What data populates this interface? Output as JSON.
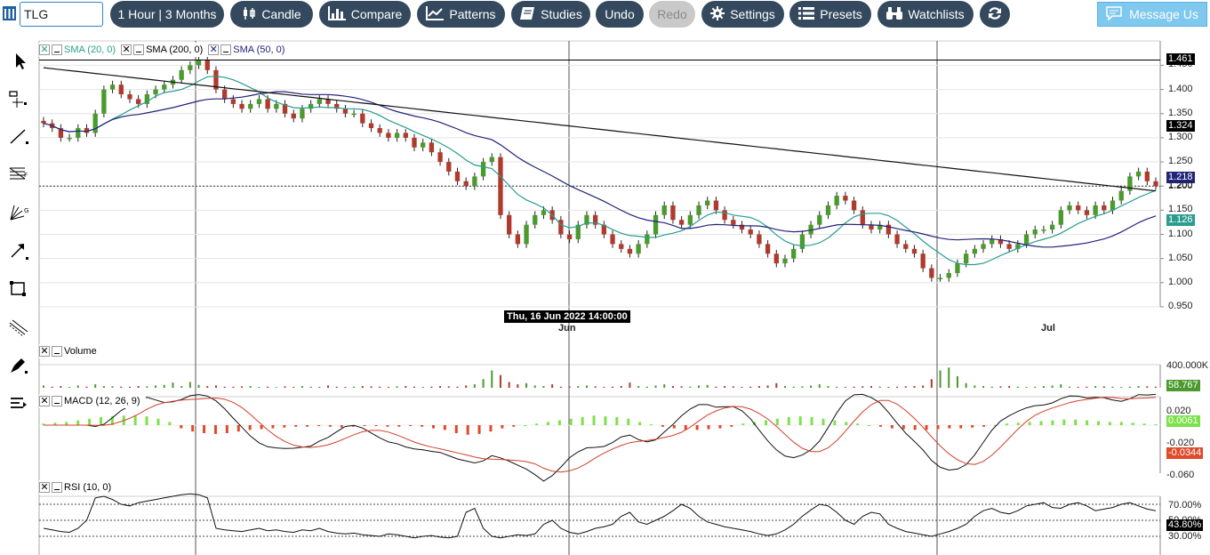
{
  "toolbar": {
    "symbol": "TLG",
    "interval": "1 Hour | 3 Months",
    "candle": "Candle",
    "compare": "Compare",
    "patterns": "Patterns",
    "studies": "Studies",
    "undo": "Undo",
    "redo": "Redo",
    "settings": "Settings",
    "presets": "Presets",
    "watchlists": "Watchlists",
    "message": "Message Us"
  },
  "price_pane": {
    "studies": [
      {
        "label": "SMA (20, 0)",
        "color": "#2a9d8f"
      },
      {
        "label": "SMA (200, 0)",
        "color": "#111111"
      },
      {
        "label": "SMA (50, 0)",
        "color": "#22237a"
      }
    ],
    "ticks": [
      "1.450",
      "1.400",
      "1.350",
      "1.300",
      "1.250",
      "1.200",
      "1.150",
      "1.100",
      "1.050",
      "1.000",
      "0.950"
    ],
    "tags": {
      "high": "1.461",
      "sma200": "1.324",
      "sma50": "1.218",
      "last": "1.200",
      "sma20": "1.126"
    }
  },
  "x_axis": {
    "crosshair": "Thu, 16 Jun 2022 14:00:00",
    "labels": [
      "Jun",
      "Jul"
    ]
  },
  "volume_pane": {
    "label": "Volume",
    "tick": "400.000K",
    "tag": "58.767"
  },
  "macd_pane": {
    "label": "MACD (12, 26, 9)",
    "ticks": [
      "0.020",
      "-0.020",
      "-0.060"
    ],
    "tag_hist": "0.0061",
    "tag_signal": "-0.0344"
  },
  "rsi_pane": {
    "label": "RSI (10, 0)",
    "ticks": [
      "70.00%",
      "50.00%",
      "30.00%"
    ],
    "tag": "43.80%"
  },
  "colors": {
    "button": "#34495e",
    "up": "#4a9a2e",
    "down": "#b03a2e",
    "sma20": "#2a9d8f",
    "sma200": "#111111",
    "sma50": "#22237a",
    "macd_pos": "#7de24a",
    "macd_neg": "#e04a2a"
  },
  "chart_data": {
    "type": "candlestick",
    "instrument": "TLG",
    "close_approx": [
      1.33,
      1.32,
      1.3,
      1.3,
      1.32,
      1.31,
      1.35,
      1.4,
      1.41,
      1.39,
      1.38,
      1.37,
      1.39,
      1.4,
      1.41,
      1.42,
      1.44,
      1.45,
      1.46,
      1.44,
      1.4,
      1.38,
      1.37,
      1.36,
      1.37,
      1.38,
      1.36,
      1.37,
      1.35,
      1.34,
      1.36,
      1.37,
      1.38,
      1.37,
      1.36,
      1.35,
      1.35,
      1.33,
      1.32,
      1.31,
      1.3,
      1.31,
      1.3,
      1.28,
      1.29,
      1.27,
      1.25,
      1.23,
      1.21,
      1.2,
      1.22,
      1.25,
      1.26,
      1.14,
      1.1,
      1.08,
      1.12,
      1.14,
      1.15,
      1.13,
      1.1,
      1.09,
      1.12,
      1.14,
      1.12,
      1.1,
      1.08,
      1.07,
      1.06,
      1.08,
      1.1,
      1.14,
      1.16,
      1.13,
      1.12,
      1.14,
      1.16,
      1.17,
      1.15,
      1.13,
      1.12,
      1.11,
      1.1,
      1.08,
      1.06,
      1.04,
      1.05,
      1.07,
      1.1,
      1.12,
      1.14,
      1.16,
      1.18,
      1.17,
      1.15,
      1.12,
      1.11,
      1.12,
      1.1,
      1.08,
      1.07,
      1.06,
      1.03,
      1.01,
      1.01,
      1.02,
      1.04,
      1.06,
      1.07,
      1.08,
      1.09,
      1.08,
      1.07,
      1.08,
      1.1,
      1.11,
      1.11,
      1.12,
      1.15,
      1.16,
      1.15,
      1.14,
      1.16,
      1.15,
      1.17,
      1.19,
      1.22,
      1.23,
      1.21,
      1.2
    ],
    "volume_approx": [
      40,
      20,
      30,
      15,
      40,
      20,
      60,
      30,
      25,
      20,
      18,
      30,
      25,
      40,
      50,
      90,
      30,
      100,
      50,
      30,
      40,
      20,
      18,
      25,
      30,
      15,
      20,
      12,
      25,
      15,
      30,
      20,
      18,
      40,
      20,
      15,
      20,
      30,
      25,
      20,
      15,
      25,
      30,
      20,
      15,
      20,
      30,
      25,
      20,
      40,
      60,
      150,
      300,
      220,
      100,
      60,
      80,
      40,
      30,
      60,
      20,
      25,
      30,
      40,
      25,
      15,
      20,
      30,
      90,
      30,
      20,
      40,
      60,
      30,
      25,
      20,
      40,
      50,
      20,
      30,
      25,
      15,
      20,
      30,
      40,
      80,
      30,
      20,
      25,
      40,
      60,
      30,
      20,
      15,
      20,
      25,
      30,
      20,
      15,
      20,
      25,
      30,
      40,
      150,
      300,
      350,
      200,
      80,
      40,
      30,
      20,
      25,
      30,
      20,
      15,
      20,
      30,
      40,
      60,
      20,
      15,
      20,
      30,
      25,
      20,
      15,
      20,
      30,
      25,
      20,
      30
    ],
    "macd_hist_approx": [
      0.002,
      0.003,
      0.004,
      0.006,
      0.008,
      0.01,
      0.011,
      0.012,
      0.012,
      0.011,
      0.008,
      0.004,
      -0.004,
      -0.008,
      -0.01,
      -0.011,
      -0.01,
      -0.008,
      -0.006,
      -0.005,
      -0.004,
      -0.003,
      -0.002,
      -0.002,
      -0.001,
      -0.002,
      -0.003,
      -0.002,
      -0.001,
      -0.001,
      -0.002,
      -0.002,
      -0.001,
      -0.002,
      -0.004,
      -0.006,
      -0.01,
      -0.012,
      -0.011,
      -0.008,
      -0.004,
      -0.002,
      0.0,
      0.002,
      0.004,
      0.006,
      0.008,
      0.01,
      0.012,
      0.011,
      0.01,
      0.008,
      0.004,
      0.001,
      -0.002,
      -0.004,
      -0.006,
      -0.006,
      -0.005,
      -0.004,
      -0.002,
      0.002,
      0.004,
      0.006,
      0.008,
      0.01,
      0.011,
      0.01,
      0.008,
      0.006,
      0.004,
      0.002,
      0.0,
      -0.002,
      -0.004,
      -0.005,
      -0.006,
      -0.006,
      -0.005,
      -0.004,
      -0.004,
      -0.003,
      -0.002,
      0.0,
      0.002,
      0.003,
      0.004,
      0.005,
      0.006,
      0.007,
      0.007,
      0.006,
      0.005,
      0.004,
      0.004,
      0.003,
      0.002,
      0.001
    ],
    "rsi_approx": [
      40,
      38,
      36,
      35,
      40,
      50,
      78,
      80,
      76,
      70,
      68,
      72,
      74,
      76,
      78,
      80,
      82,
      83,
      82,
      78,
      40,
      38,
      37,
      36,
      38,
      40,
      37,
      38,
      36,
      35,
      38,
      37,
      40,
      36,
      34,
      33,
      34,
      32,
      31,
      30,
      33,
      32,
      30,
      28,
      30,
      31,
      29,
      28,
      30,
      60,
      65,
      40,
      30,
      28,
      30,
      32,
      31,
      33,
      45,
      50,
      40,
      35,
      33,
      36,
      40,
      42,
      45,
      55,
      60,
      48,
      45,
      50,
      55,
      62,
      70,
      65,
      55,
      48,
      45,
      42,
      40,
      38,
      36,
      33,
      31,
      33,
      38,
      45,
      55,
      63,
      70,
      68,
      60,
      50,
      45,
      55,
      60,
      58,
      45,
      40,
      36,
      34,
      32,
      30,
      33,
      36,
      40,
      45,
      55,
      62,
      65,
      60,
      58,
      62,
      68,
      70,
      72,
      66,
      65,
      70,
      72,
      68,
      62,
      64,
      66,
      70,
      72,
      68,
      64,
      62,
      63
    ],
    "crosshair_time": "Thu, 16 Jun 2022 14:00:00",
    "x_labels": [
      "Jun",
      "Jul"
    ],
    "price_range": [
      0.95,
      1.46
    ],
    "grid": true
  }
}
